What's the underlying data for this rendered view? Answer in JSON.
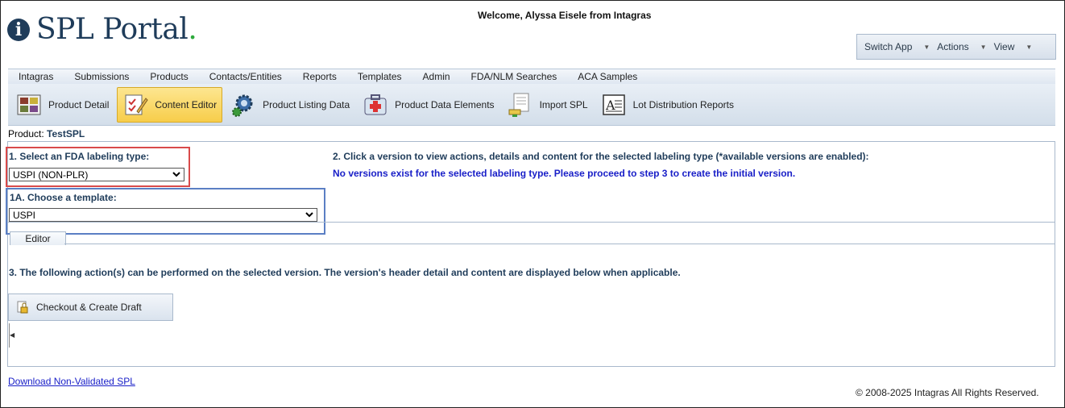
{
  "header": {
    "app_name": "SPL Portal",
    "welcome_text": "Welcome, Alyssa Eisele from Intagras"
  },
  "app_menu": {
    "items": [
      {
        "label": "Switch App"
      },
      {
        "label": "Actions"
      },
      {
        "label": "View"
      }
    ]
  },
  "nav": {
    "items": [
      {
        "label": "Intagras"
      },
      {
        "label": "Submissions"
      },
      {
        "label": "Products"
      },
      {
        "label": "Contacts/Entities"
      },
      {
        "label": "Reports"
      },
      {
        "label": "Templates"
      },
      {
        "label": "Admin"
      },
      {
        "label": "FDA/NLM Searches"
      },
      {
        "label": "ACA Samples"
      }
    ]
  },
  "toolbar": {
    "items": [
      {
        "label": "Product Detail",
        "icon": "product-detail-icon",
        "active": false
      },
      {
        "label": "Content Editor",
        "icon": "content-editor-icon",
        "active": true
      },
      {
        "label": "Product Listing Data",
        "icon": "gear-icon",
        "active": false
      },
      {
        "label": "Product Data Elements",
        "icon": "medical-kit-icon",
        "active": false
      },
      {
        "label": "Import SPL",
        "icon": "import-icon",
        "active": false
      },
      {
        "label": "Lot Distribution Reports",
        "icon": "document-icon",
        "active": false
      }
    ]
  },
  "product": {
    "label": "Product:",
    "name": "TestSPL"
  },
  "step1": {
    "label": "1. Select an FDA labeling type:",
    "selected": "USPI (NON-PLR)"
  },
  "step1a": {
    "label": "1A. Choose a template:",
    "selected": "USPI"
  },
  "step2": {
    "instruction": "2. Click a version to view actions, details and content for the selected labeling type (*available versions are enabled):",
    "message": "No versions exist for the selected labeling type. Please proceed to step 3 to create the initial version."
  },
  "tabs": {
    "editor_label": "Editor"
  },
  "step3": {
    "instruction": "3. The following action(s) can be performed on the selected version. The version's header detail and content are displayed below when applicable.",
    "checkout_button": "Checkout & Create Draft"
  },
  "footer": {
    "download_link": "Download Non-Validated SPL",
    "copyright": "© 2008-2025 Intagras All Rights Reserved."
  },
  "colors": {
    "brand_navy": "#1f3c5a",
    "brand_green": "#2eaa3c",
    "active_tool": "#f7cd4a",
    "highlight_red": "#d94a4a",
    "highlight_blue": "#5b7fc4",
    "message_blue": "#1a20c8"
  }
}
